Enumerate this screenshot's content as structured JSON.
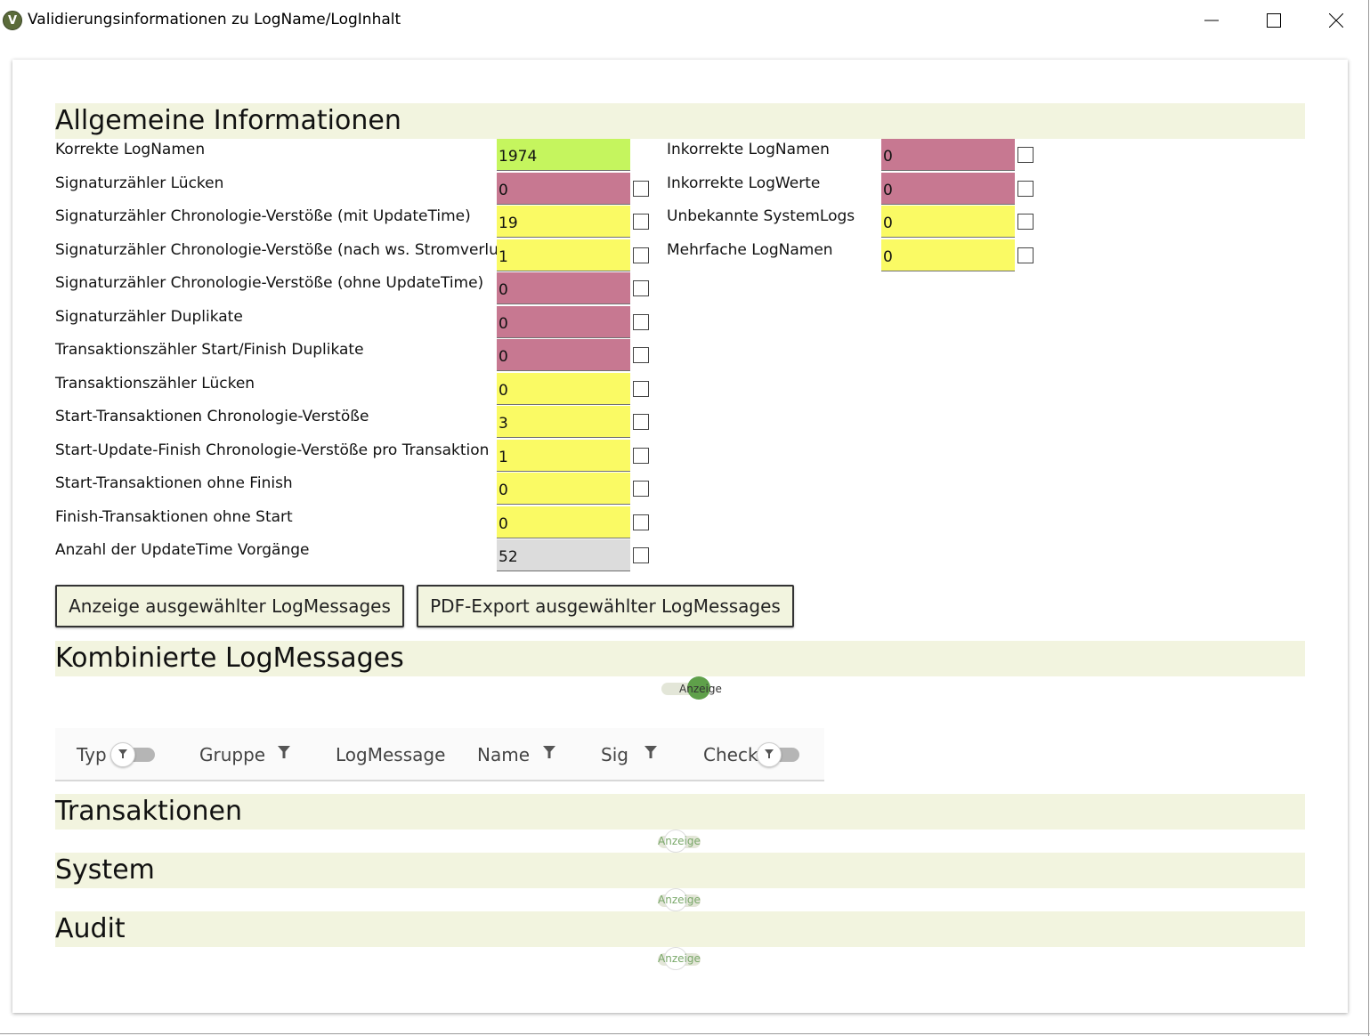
{
  "window": {
    "title": "Validierungsinformationen zu LogName/LogInhalt",
    "app_icon": "V",
    "icons": [
      "minimize-icon",
      "maximize-icon",
      "close-icon"
    ]
  },
  "colors": {
    "green": "#c5f55e",
    "red": "#c77891",
    "yellow": "#fafa64",
    "gray": "#dcdcdc",
    "section_bg": "#f2f4df",
    "toggle_green": "#5fa04a"
  },
  "general": {
    "title": "Allgemeine Informationen",
    "left_rows": [
      {
        "label": "Korrekte LogNamen",
        "value": "1974",
        "status": "green",
        "checkbox": false
      },
      {
        "label": "Signaturzähler Lücken",
        "value": "0",
        "status": "red",
        "checkbox": true
      },
      {
        "label": "Signaturzähler Chronologie-Verstöße (mit UpdateTime)",
        "value": "19",
        "status": "yellow",
        "checkbox": true
      },
      {
        "label": "Signaturzähler Chronologie-Verstöße (nach ws. Stromverlust)",
        "value": "1",
        "status": "yellow",
        "checkbox": true
      },
      {
        "label": "Signaturzähler Chronologie-Verstöße (ohne UpdateTime)",
        "value": "0",
        "status": "red",
        "checkbox": true
      },
      {
        "label": "Signaturzähler Duplikate",
        "value": "0",
        "status": "red",
        "checkbox": true
      },
      {
        "label": "Transaktionszähler Start/Finish Duplikate",
        "value": "0",
        "status": "red",
        "checkbox": true
      },
      {
        "label": "Transaktionszähler Lücken",
        "value": "0",
        "status": "yellow",
        "checkbox": true
      },
      {
        "label": "Start-Transaktionen Chronologie-Verstöße",
        "value": "3",
        "status": "yellow",
        "checkbox": true
      },
      {
        "label": "Start-Update-Finish Chronologie-Verstöße pro Transaktion",
        "value": "1",
        "status": "yellow",
        "checkbox": true
      },
      {
        "label": "Start-Transaktionen ohne Finish",
        "value": "0",
        "status": "yellow",
        "checkbox": true
      },
      {
        "label": "Finish-Transaktionen ohne Start",
        "value": "0",
        "status": "yellow",
        "checkbox": true
      },
      {
        "label": "Anzahl der UpdateTime Vorgänge",
        "value": "52",
        "status": "gray",
        "checkbox": true
      }
    ],
    "right_rows": [
      {
        "label": "Inkorrekte LogNamen",
        "value": "0",
        "status": "red",
        "checkbox": true
      },
      {
        "label": "Inkorrekte LogWerte",
        "value": "0",
        "status": "red",
        "checkbox": true
      },
      {
        "label": "Unbekannte SystemLogs",
        "value": "0",
        "status": "yellow",
        "checkbox": true
      },
      {
        "label": "Mehrfache LogNamen",
        "value": "0",
        "status": "yellow",
        "checkbox": true
      }
    ]
  },
  "buttons": {
    "show_selected": "Anzeige ausgewählter LogMessages",
    "pdf_export": "PDF-Export ausgewählter LogMessages"
  },
  "combined": {
    "title": "Kombinierte LogMessages",
    "toggle_label": "Anzeige",
    "toggle_on": true,
    "columns": [
      {
        "label": "Typ",
        "control": "filter-toggle"
      },
      {
        "label": "Gruppe",
        "control": "filter"
      },
      {
        "label": "LogMessage",
        "control": "none"
      },
      {
        "label": "Name",
        "control": "filter"
      },
      {
        "label": "Sig",
        "control": "filter"
      },
      {
        "label": "Check",
        "control": "filter-toggle"
      }
    ]
  },
  "sections": [
    {
      "title": "Transaktionen",
      "toggle_label": "Anzeige",
      "toggle_on": false
    },
    {
      "title": "System",
      "toggle_label": "Anzeige",
      "toggle_on": false
    },
    {
      "title": "Audit",
      "toggle_label": "Anzeige",
      "toggle_on": false
    }
  ]
}
